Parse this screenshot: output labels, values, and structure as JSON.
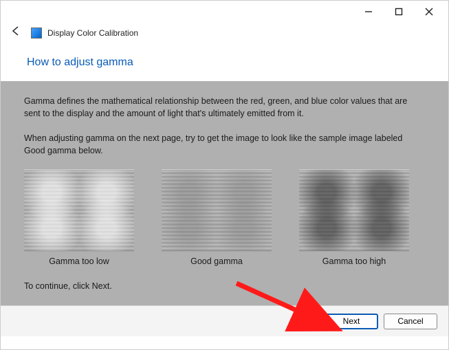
{
  "window": {
    "app_title": "Display Color Calibration"
  },
  "page": {
    "heading": "How to adjust gamma",
    "paragraph1": "Gamma defines the mathematical relationship between the red, green, and blue color values that are sent to the display and the amount of light that's ultimately emitted from it.",
    "paragraph2": "When adjusting gamma on the next page, try to get the image to look like the sample image labeled Good gamma below.",
    "continue_text": "To continue, click Next."
  },
  "samples": {
    "low": "Gamma too low",
    "good": "Good gamma",
    "high": "Gamma too high"
  },
  "buttons": {
    "next": "Next",
    "cancel": "Cancel"
  }
}
